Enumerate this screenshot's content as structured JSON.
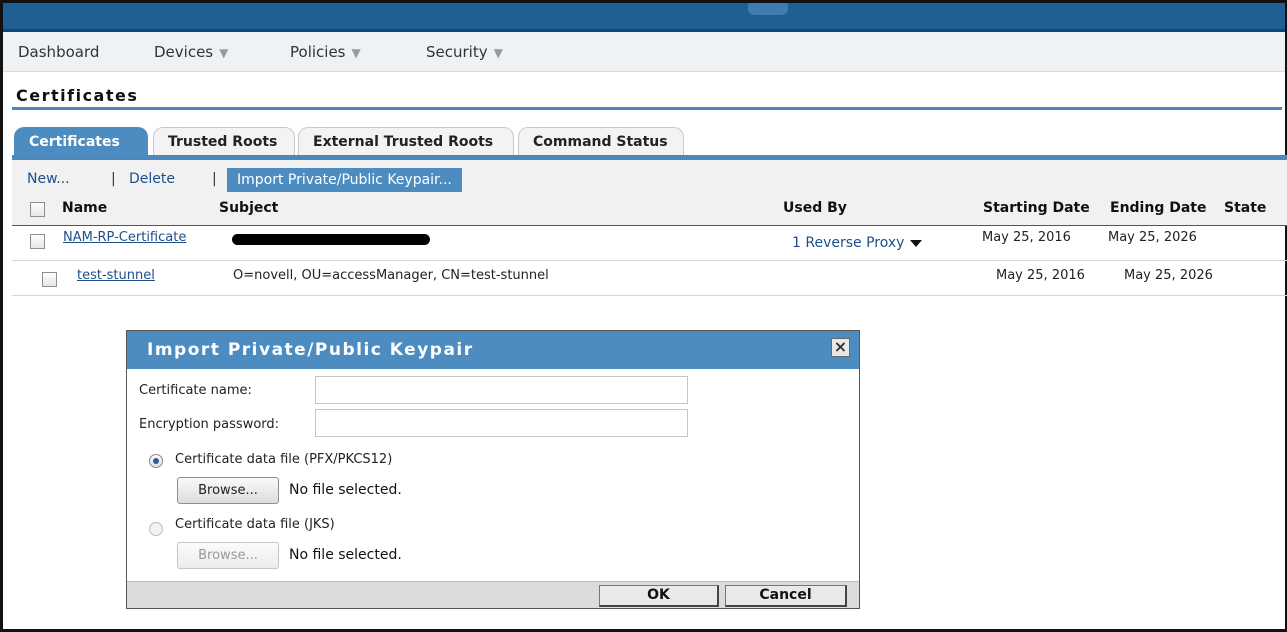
{
  "nav": {
    "items": [
      {
        "label": "Dashboard",
        "dropdown": false
      },
      {
        "label": "Devices",
        "dropdown": true
      },
      {
        "label": "Policies",
        "dropdown": true
      },
      {
        "label": "Security",
        "dropdown": true
      }
    ],
    "caret_glyph": "▼"
  },
  "page": {
    "title": "Certificates"
  },
  "tabs": [
    {
      "label": "Certificates",
      "active": true
    },
    {
      "label": "Trusted Roots",
      "active": false
    },
    {
      "label": "External Trusted Roots",
      "active": false
    },
    {
      "label": "Command Status",
      "active": false
    }
  ],
  "toolbar": {
    "new_label": "New...",
    "delete_label": "Delete",
    "import_label": "Import Private/Public Keypair...",
    "separator": "|"
  },
  "table": {
    "columns": [
      "Name",
      "Subject",
      "Used By",
      "Starting Date",
      "Ending Date",
      "State"
    ],
    "rows": [
      {
        "name": "NAM-RP-Certificate",
        "subject": "",
        "used_by": "1 Reverse Proxy",
        "start": "May 25, 2016",
        "end": "May 25, 2026",
        "state": ""
      },
      {
        "name": "test-stunnel",
        "subject": "O=novell, OU=accessManager, CN=test-stunnel",
        "used_by": "",
        "start": "May 25, 2016",
        "end": "May 25, 2026",
        "state": ""
      }
    ]
  },
  "dialog": {
    "title": "Import Private/Public Keypair",
    "close_glyph": "×",
    "cert_name_label": "Certificate name:",
    "cert_name_value": "",
    "password_label": "Encryption password:",
    "password_value": "",
    "option_pfx_label": "Certificate data file (PFX/PKCS12)",
    "option_pfx_selected": true,
    "option_jks_label": "Certificate data file (JKS)",
    "option_jks_selected": false,
    "browse_label": "Browse...",
    "no_file_text": "No file selected.",
    "ok_label": "OK",
    "cancel_label": "Cancel"
  },
  "colors": {
    "topbar": "#1f5f93",
    "accent": "#4d8cc0",
    "link": "#1c4f8a"
  }
}
